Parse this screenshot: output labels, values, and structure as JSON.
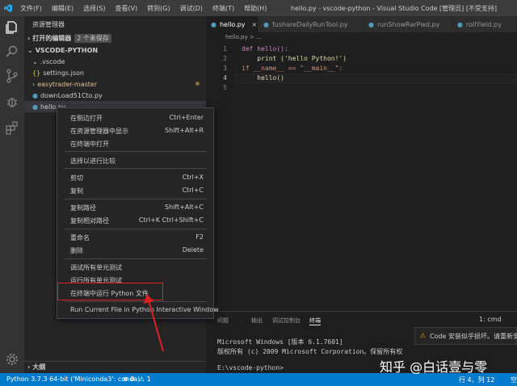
{
  "titlebar": {
    "menu": [
      "文件(F)",
      "编辑(E)",
      "选择(S)",
      "查看(V)",
      "转到(G)",
      "调试(D)",
      "终端(T)",
      "帮助(H)"
    ],
    "title": "hello.py - vscode-python - Visual Studio Code [管理员] [不受支持]"
  },
  "sidebar": {
    "header": "资源管理器",
    "open_editors": "打开的编辑器",
    "unsaved_badge": "2 个未保存",
    "project": "VSCODE-PYTHON",
    "items": [
      ".vscode",
      "settings.json",
      "easytrader-master",
      "downLoad51Cto.py",
      "hello.py"
    ],
    "outline": "大纲"
  },
  "tabs": [
    "hello.py",
    "fushareDailyRunTool.py",
    "runShowRarPwd.py",
    "rollYield.py"
  ],
  "breadcrumb": "hello.py > ...",
  "editor": {
    "line_numbers": [
      "1",
      "2",
      "3",
      "4",
      "5"
    ],
    "lines": [
      "def hello():",
      "    print ('hello Python!')",
      "if __name__ == \"__main__\":",
      "    hello()",
      ""
    ]
  },
  "panel": {
    "tabs": [
      "问题",
      "输出",
      "调试控制台",
      "终端"
    ],
    "terminal_select": "1: cmd",
    "terminal_lines": [
      "Microsoft Windows [版本 6.1.7601]",
      "版权所有 (c) 2009 Microsoft Corporation。保留所有权",
      "",
      "E:\\vscode-python>"
    ]
  },
  "context_menu": {
    "items": [
      {
        "label": "在侧边打开",
        "shortcut": "Ctrl+Enter"
      },
      {
        "label": "在资源管理器中显示",
        "shortcut": "Shift+Alt+R"
      },
      {
        "label": "在终端中打开",
        "shortcut": ""
      },
      {
        "label": "选择以进行比较",
        "shortcut": ""
      },
      {
        "label": "剪切",
        "shortcut": "Ctrl+X"
      },
      {
        "label": "复制",
        "shortcut": "Ctrl+C"
      },
      {
        "label": "复制路径",
        "shortcut": "Shift+Alt+C"
      },
      {
        "label": "复制相对路径",
        "shortcut": "Ctrl+K Ctrl+Shift+C"
      },
      {
        "label": "重命名",
        "shortcut": "F2"
      },
      {
        "label": "删除",
        "shortcut": "Delete"
      },
      {
        "label": "调试所有单元测试",
        "shortcut": ""
      },
      {
        "label": "运行所有单元测试",
        "shortcut": ""
      },
      {
        "label": "在终端中运行 Python 文件",
        "shortcut": ""
      },
      {
        "label": "Run Current File in Python Interactive Window",
        "shortcut": ""
      }
    ]
  },
  "notification": "Code 安装似乎损坏。请重新安",
  "statusbar": {
    "interpreter": "Python 3.7.3 64-bit ('Miniconda3': conda)",
    "errors": "0",
    "warnings": "1",
    "position": "行 4，列 12",
    "spaces": "空"
  },
  "watermark": "知乎 @白话壹与零",
  "colors": {
    "accent": "#007acc",
    "keyword": "#c586c0",
    "function": "#dcdcaa",
    "string": "#ce9178",
    "folder_modified": "#e2c08d",
    "highlight": "#e02020"
  }
}
